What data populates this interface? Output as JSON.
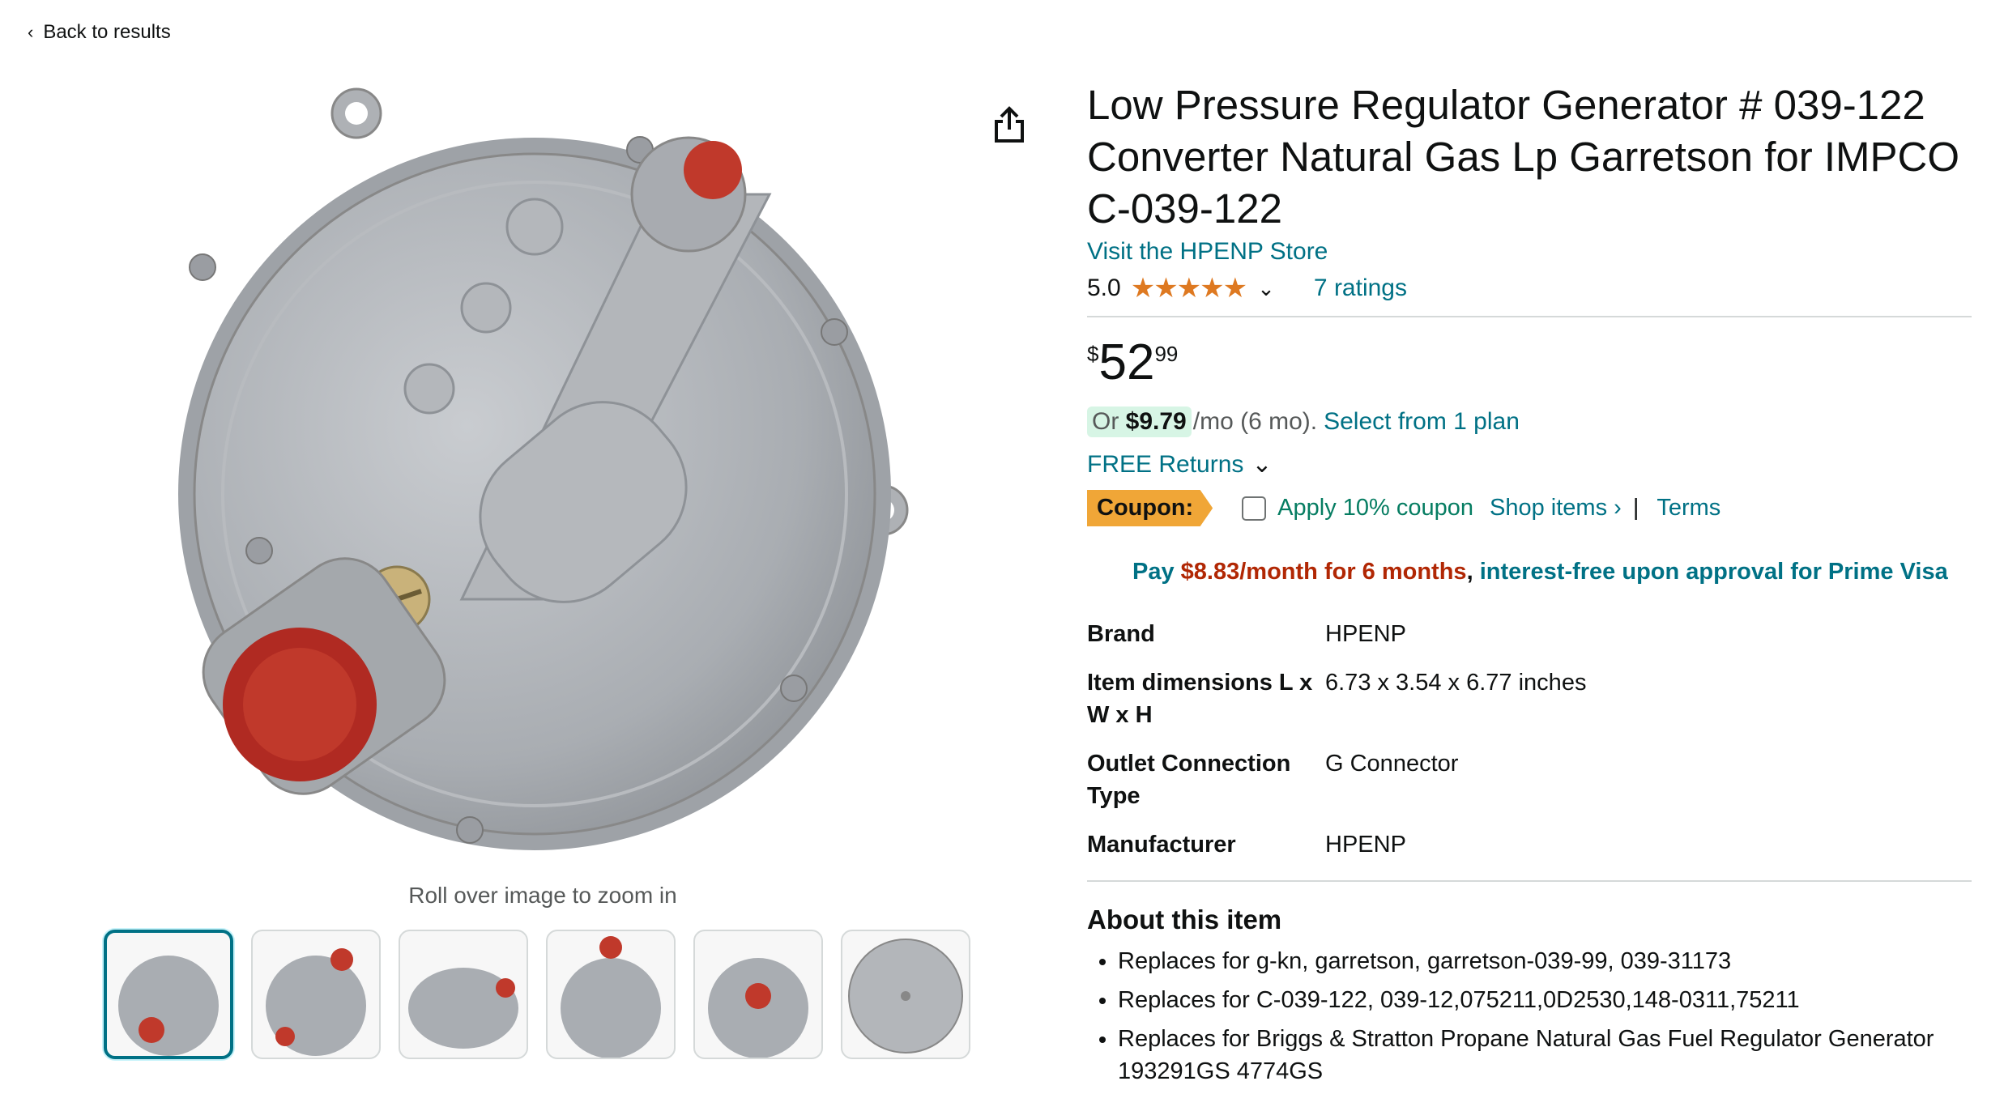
{
  "nav": {
    "back_label": "Back to results"
  },
  "gallery": {
    "zoom_hint": "Roll over image to zoom in",
    "thumbnails": [
      "thumb-1",
      "thumb-2",
      "thumb-3",
      "thumb-4",
      "thumb-5",
      "thumb-6"
    ],
    "main_image_icon": "gas-regulator-image"
  },
  "product": {
    "title": "Low Pressure Regulator Generator # 039-122 Converter Natural Gas Lp Garretson for IMPCO C-039-122",
    "store_link": "Visit the HPENP Store",
    "rating_value": "5.0",
    "stars": "★★★★★",
    "ratings_count": "7 ratings"
  },
  "price": {
    "symbol": "$",
    "whole": "52",
    "fraction": "99",
    "finance_prefix": "Or",
    "finance_amount": "$9.79",
    "finance_suffix": "/mo (6 mo).",
    "finance_link": "Select from 1 plan",
    "returns": "FREE Returns"
  },
  "coupon": {
    "tag": "Coupon:",
    "apply": "Apply 10% coupon",
    "shop": "Shop items ›",
    "separator": "|",
    "terms": "Terms"
  },
  "prime_offer": {
    "pay": "Pay",
    "amount": "$8.83/month for 6 months",
    "comma": ",",
    "rest": "interest-free upon approval for Prime Visa"
  },
  "specs": [
    {
      "key": "Brand",
      "value": "HPENP"
    },
    {
      "key": "Item dimensions L x W x H",
      "value": "6.73 x 3.54 x 6.77 inches"
    },
    {
      "key": "Outlet Connection Type",
      "value": "G Connector"
    },
    {
      "key": "Manufacturer",
      "value": "HPENP"
    }
  ],
  "about": {
    "heading": "About this item",
    "bullets": [
      "Replaces for g-kn, garretson, garretson-039-99, 039-31173",
      "Replaces for C-039-122, 039-12,075211,0D2530,148-0311,75211",
      "Replaces for Briggs & Stratton Propane Natural Gas Fuel Regulator Generator 193291GS 4774GS"
    ]
  },
  "colors": {
    "link": "#007185",
    "star": "#de7921",
    "coupon": "#f0a637",
    "deal": "#b12704",
    "green": "#067d62"
  }
}
